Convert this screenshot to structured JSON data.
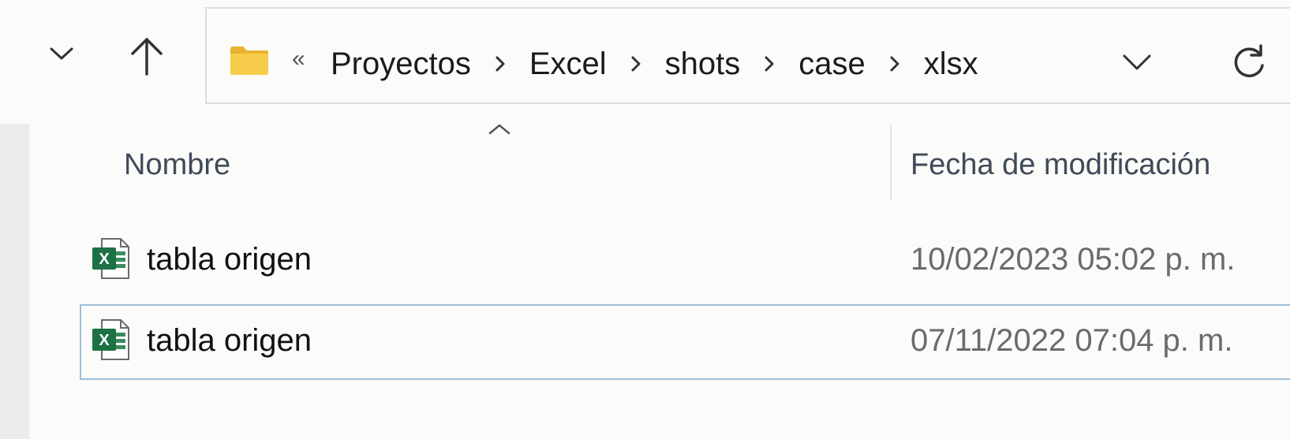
{
  "navigation": {
    "recent_icon": "chevron-down-icon",
    "up_icon": "arrow-up-icon"
  },
  "address_bar": {
    "folder_icon": "folder-icon",
    "overflow": "«",
    "breadcrumbs": [
      "Proyectos",
      "Excel",
      "shots",
      "case",
      "xlsx"
    ],
    "dropdown_icon": "chevron-down-icon",
    "refresh_icon": "refresh-icon"
  },
  "columns": {
    "name": "Nombre",
    "date_modified": "Fecha de modificación",
    "sort_indicator": "sort-ascending-icon"
  },
  "files": [
    {
      "name": "tabla origen",
      "date": "10/02/2023 05:02 p. m.",
      "icon": "excel-file-icon",
      "selected": false
    },
    {
      "name": "tabla origen",
      "date": "07/11/2022 07:04 p. m.",
      "icon": "excel-file-icon",
      "selected": true
    }
  ],
  "colors": {
    "selection_border": "#9fbcd9",
    "folder_yellow": "#f5c542",
    "excel_green": "#1d7044"
  }
}
